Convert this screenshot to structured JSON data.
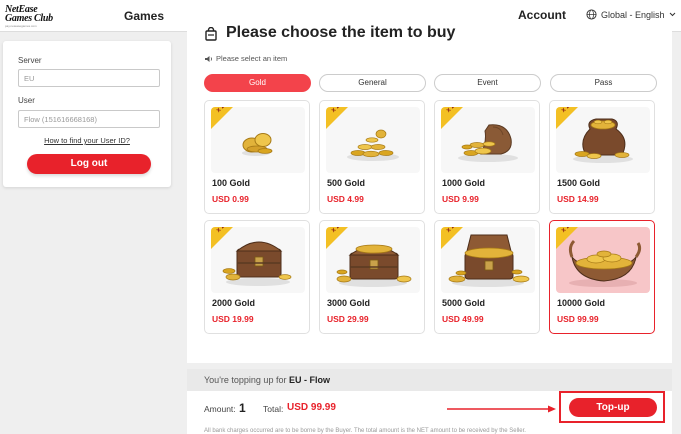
{
  "header": {
    "logo_line1": "NetEase",
    "logo_line2": "Games Club",
    "logo_sub": "pay.neteasegames.com",
    "games": "Games",
    "account": "Account",
    "language": "Global - English"
  },
  "login": {
    "server_label": "Server",
    "server_value": "EU",
    "user_label": "User",
    "user_value": "Flow (151616668168)",
    "help_link": "How to find your User ID?",
    "logout": "Log out"
  },
  "store": {
    "title": "Please choose the item to buy",
    "subtitle": "Please select an item",
    "tabs": [
      {
        "label": "Gold",
        "active": true
      },
      {
        "label": "General",
        "active": false
      },
      {
        "label": "Event",
        "active": false
      },
      {
        "label": "Pass",
        "active": false
      }
    ],
    "items": [
      {
        "name": "100 Gold",
        "price": "USD 0.99",
        "badge": "x 2",
        "art": "coins-small",
        "selected": false
      },
      {
        "name": "500 Gold",
        "price": "USD 4.99",
        "badge": "x 2",
        "art": "coins-pile",
        "selected": false
      },
      {
        "name": "1000 Gold",
        "price": "USD 9.99",
        "badge": "x 2",
        "art": "coin-sack",
        "selected": false
      },
      {
        "name": "1500 Gold",
        "price": "USD 14.99",
        "badge": "x 2",
        "art": "coin-bag",
        "selected": false
      },
      {
        "name": "2000 Gold",
        "price": "USD 19.99",
        "badge": "x 2",
        "art": "chest-small",
        "selected": false
      },
      {
        "name": "3000 Gold",
        "price": "USD 29.99",
        "badge": "x 2",
        "art": "chest-large",
        "selected": false
      },
      {
        "name": "5000 Gold",
        "price": "USD 49.99",
        "badge": "x 2",
        "art": "chest-open",
        "selected": false
      },
      {
        "name": "10000 Gold",
        "price": "USD 99.99",
        "badge": "x 2",
        "art": "gold-ship",
        "selected": true
      }
    ]
  },
  "summary": {
    "topping_prefix": "You're topping up for",
    "target": "EU - Flow",
    "amount_label": "Amount:",
    "amount_value": "1",
    "total_label": "Total:",
    "total_value": "USD 99.99",
    "topup": "Top-up",
    "disclaimer": "All bank charges occurred are to be borne by the Buyer. The total amount is the NET amount to be received by the Seller."
  },
  "colors": {
    "accent": "#e8222b",
    "badge": "#f3c024",
    "gold": "#d9a520"
  }
}
